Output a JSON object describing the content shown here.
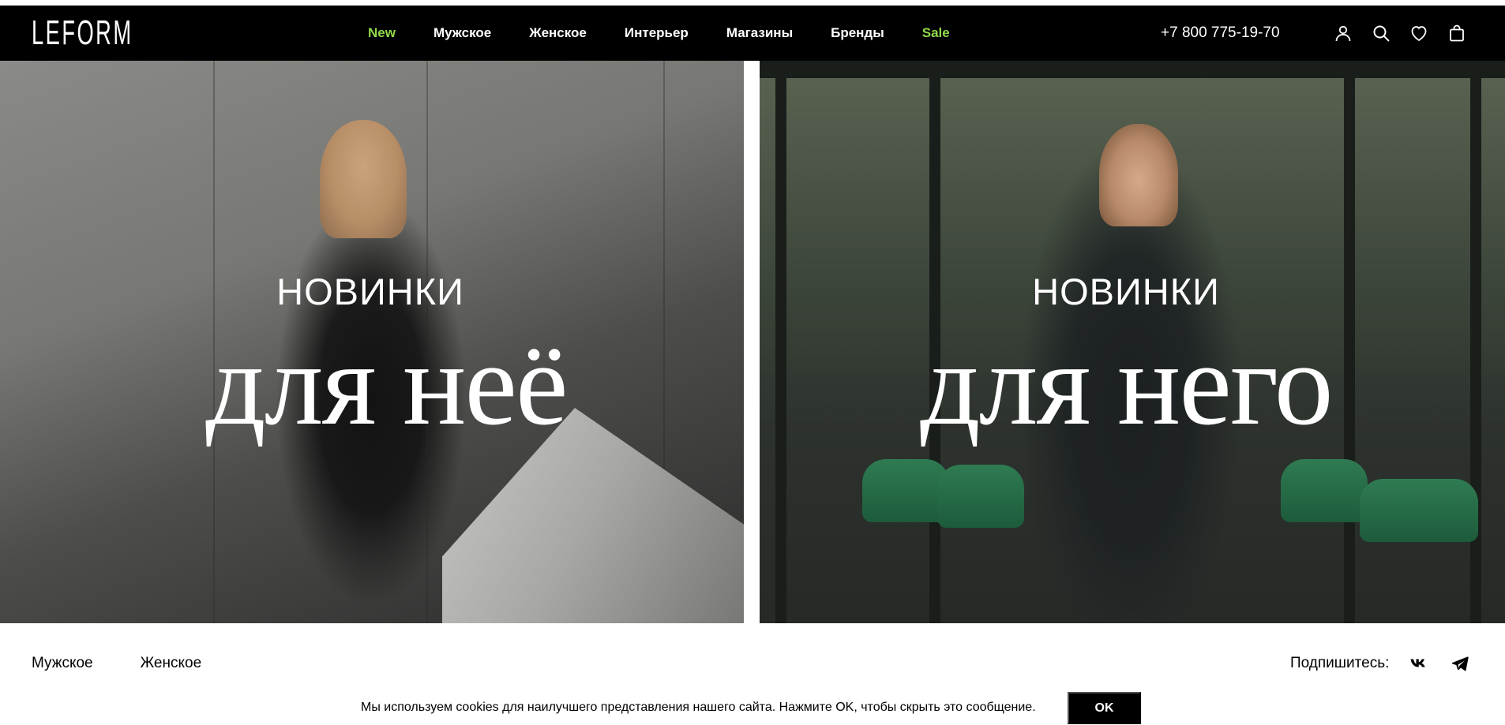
{
  "header": {
    "logo": "LEFORM",
    "nav": [
      {
        "label": "New",
        "accent": true
      },
      {
        "label": "Мужское",
        "accent": false
      },
      {
        "label": "Женское",
        "accent": false
      },
      {
        "label": "Интерьер",
        "accent": false
      },
      {
        "label": "Магазины",
        "accent": false
      },
      {
        "label": "Бренды",
        "accent": false
      },
      {
        "label": "Sale",
        "accent": true
      }
    ],
    "phone": "+7 800 775-19-70",
    "icons": [
      "user-icon",
      "search-icon",
      "heart-icon",
      "bag-icon"
    ]
  },
  "banners": [
    {
      "small": "НОВИНКИ",
      "big": "для неё"
    },
    {
      "small": "НОВИНКИ",
      "big": "для него"
    }
  ],
  "footer": {
    "links": [
      "Мужское",
      "Женское"
    ],
    "subscribe_label": "Подпишитесь:",
    "social": [
      "vk-icon",
      "telegram-icon"
    ]
  },
  "cookie": {
    "text": "Мы используем cookies для наилучшего представления нашего сайта. Нажмите OK, чтобы скрыть это сообщение.",
    "button": "OK"
  },
  "colors": {
    "header_bg": "#000000",
    "accent_green": "#8fd94a",
    "page_bg": "#ffffff"
  }
}
